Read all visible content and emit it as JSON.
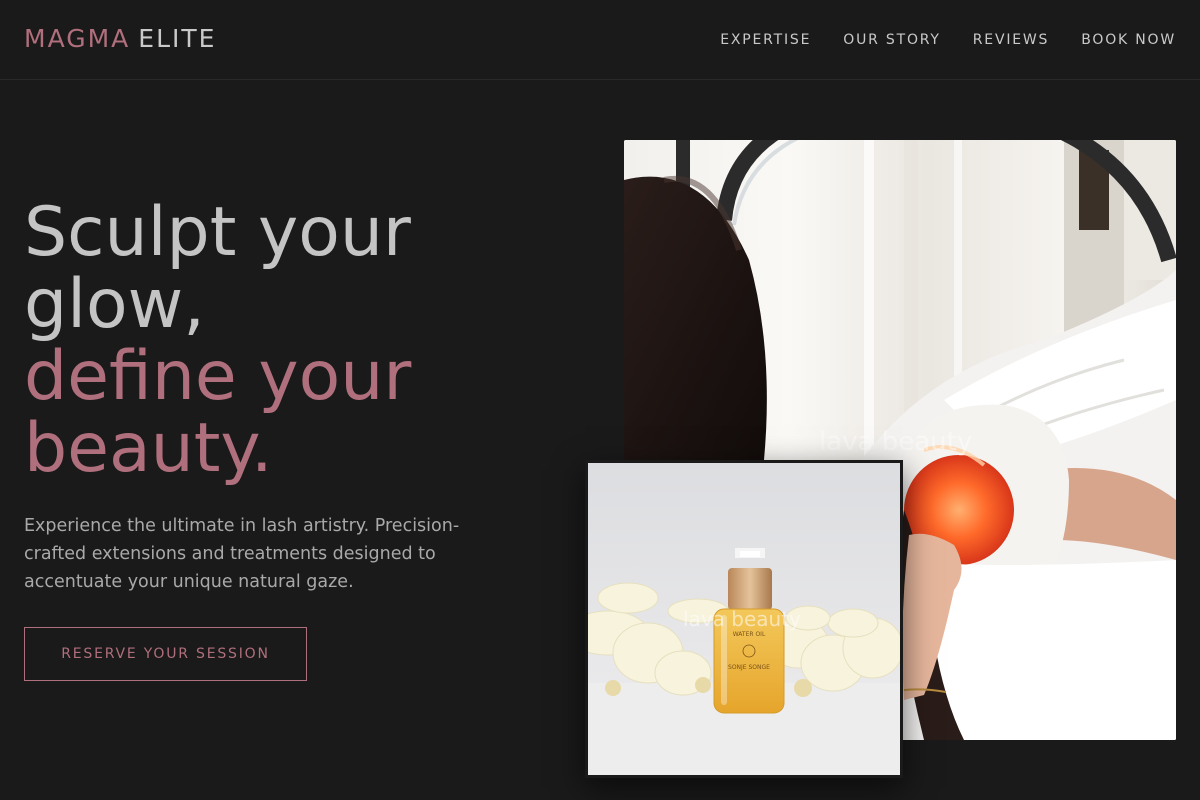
{
  "brand": {
    "first": "MAGMA",
    "second": "ELITE"
  },
  "nav": [
    {
      "label": "EXPERTISE"
    },
    {
      "label": "OUR STORY"
    },
    {
      "label": "REVIEWS"
    },
    {
      "label": "BOOK NOW"
    }
  ],
  "hero": {
    "title_line1": "Sculpt your glow,",
    "title_line2": "define your beauty.",
    "description": "Experience the ultimate in lash artistry. Precision-crafted extensions and treatments designed to accentuate your unique natural gaze.",
    "cta_label": "RESERVE YOUR SESSION"
  },
  "images": {
    "main_watermark": "lava beauty",
    "small_watermark": "lava beauty",
    "bottle_label_top": "WATER OIL",
    "bottle_label_brand": "SONJE SONGE"
  },
  "colors": {
    "background": "#1a1a1a",
    "accent": "#b06f7c",
    "text": "#c4c4c4"
  }
}
